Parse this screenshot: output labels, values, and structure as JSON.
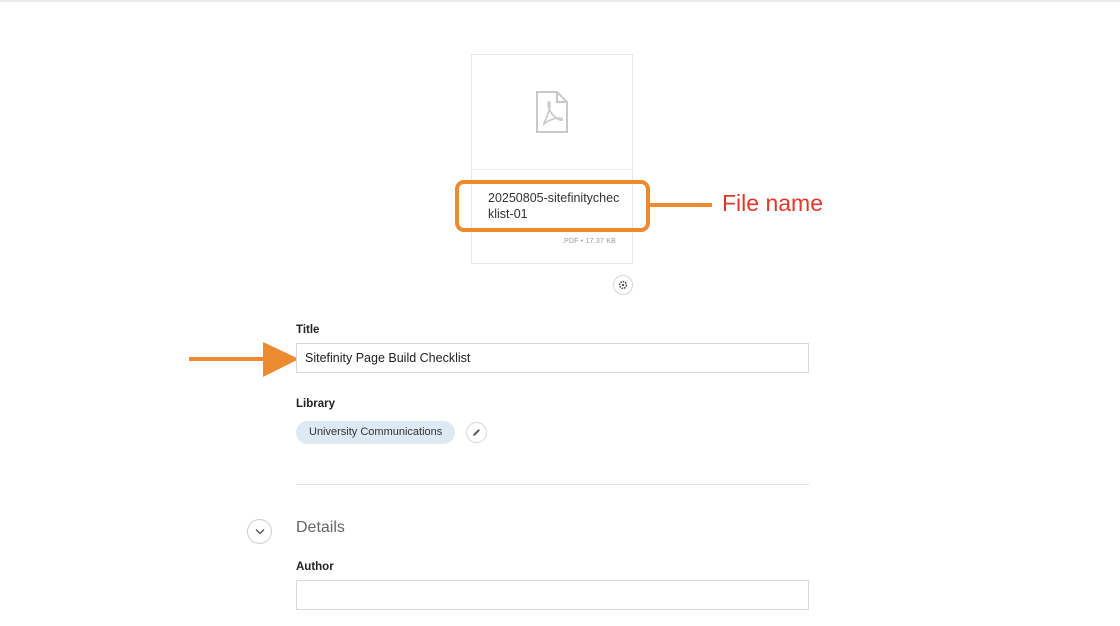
{
  "file": {
    "name": "20250805-sitefinitychecklist-01",
    "meta": ".PDF • 17.37 KB",
    "icon": "pdf-file-icon"
  },
  "annotations": {
    "file_name_label": "File name",
    "colors": {
      "highlight": "#ec8b2f",
      "label": "#e0382b"
    }
  },
  "form": {
    "title_label": "Title",
    "title_value": "Sitefinity Page Build Checklist",
    "library_label": "Library",
    "library_value": "University Communications",
    "details_heading": "Details",
    "author_label": "Author",
    "author_value": ""
  },
  "icons": {
    "settings": "gear-icon",
    "edit": "pencil-icon",
    "expand": "chevron-down-icon"
  },
  "colors": {
    "chip_bg": "#dde9f3",
    "border": "#d9d9d9"
  }
}
